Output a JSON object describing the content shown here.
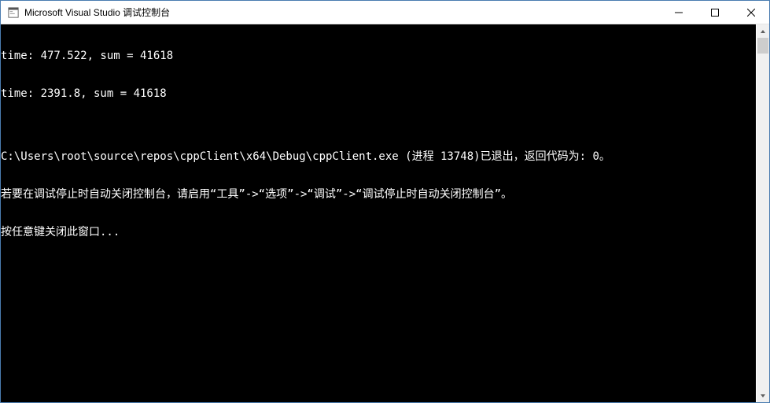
{
  "window": {
    "title": "Microsoft Visual Studio 调试控制台"
  },
  "console": {
    "lines": [
      "time: 477.522, sum = 41618",
      "time: 2391.8, sum = 41618",
      "",
      "C:\\Users\\root\\source\\repos\\cppClient\\x64\\Debug\\cppClient.exe (进程 13748)已退出，返回代码为: 0。",
      "若要在调试停止时自动关闭控制台，请启用“工具”->“选项”->“调试”->“调试停止时自动关闭控制台”。",
      "按任意键关闭此窗口..."
    ]
  }
}
